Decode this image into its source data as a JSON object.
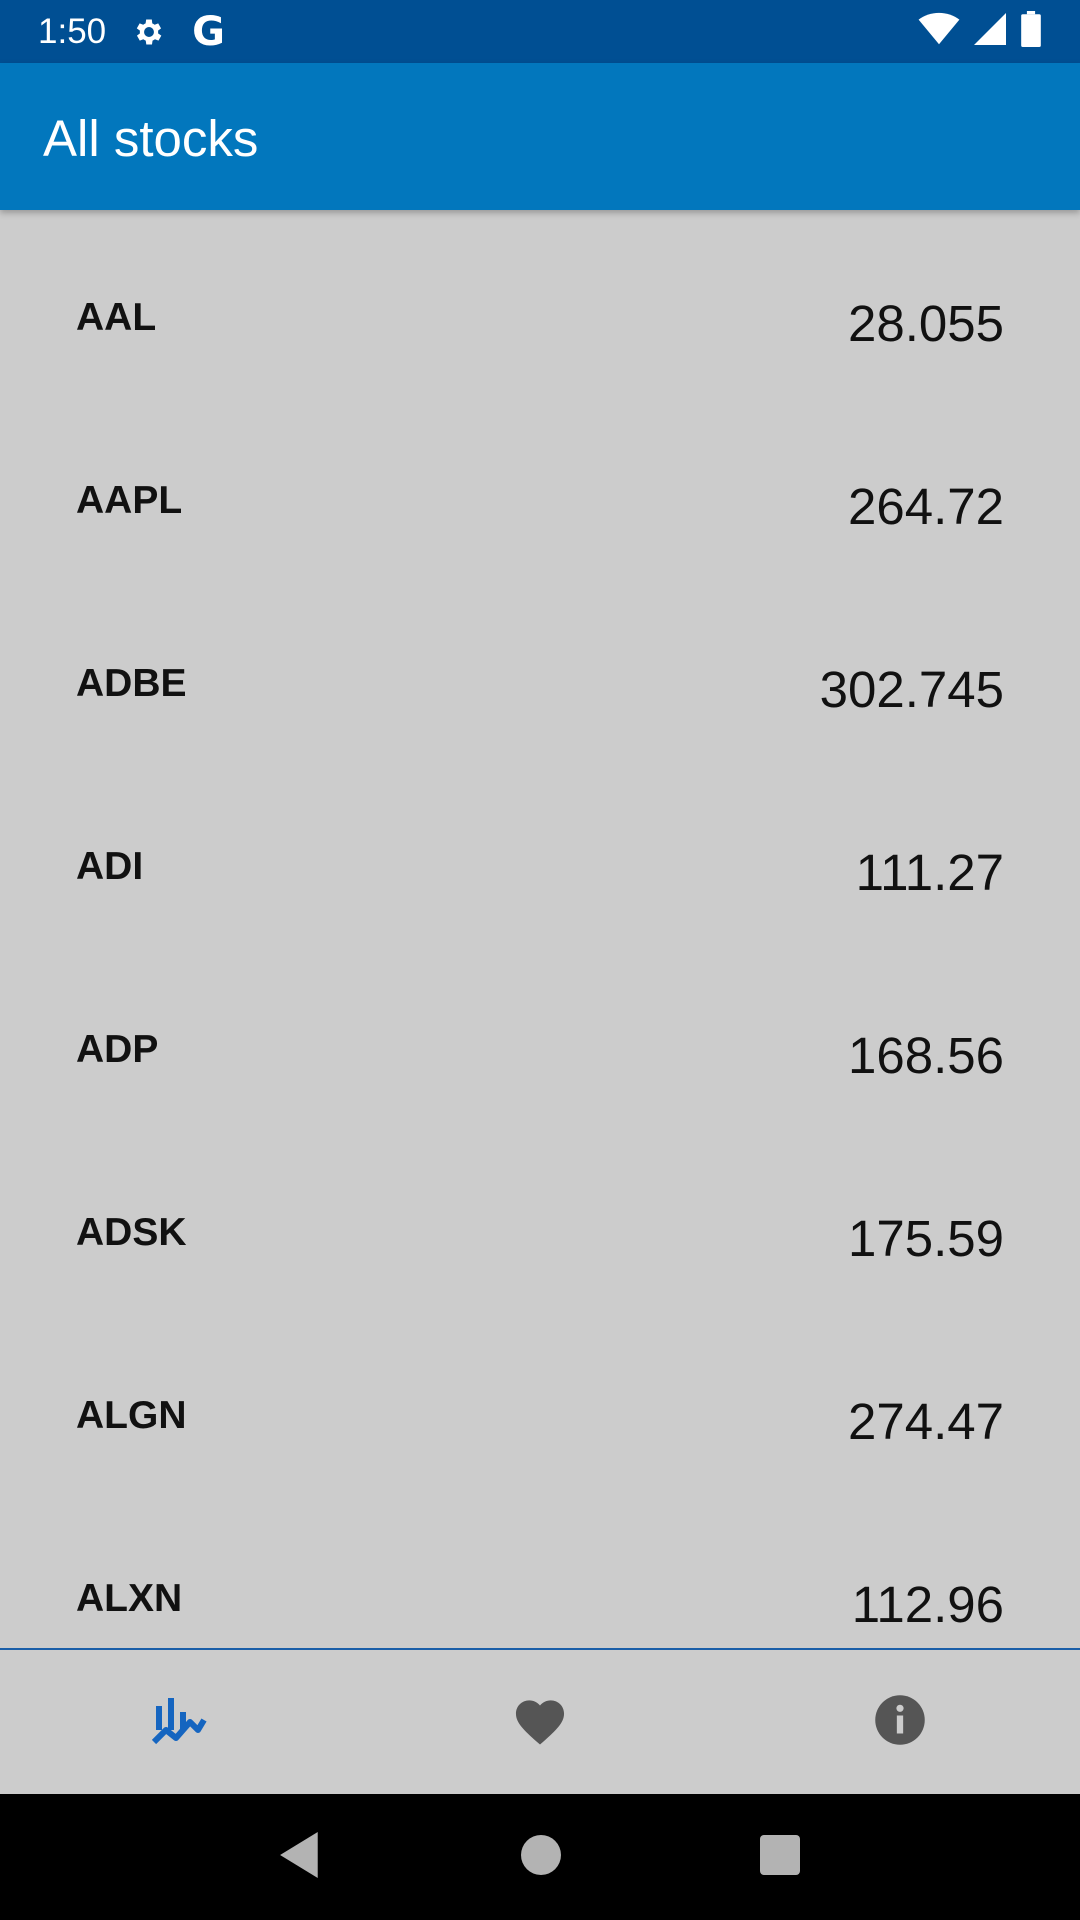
{
  "status_bar": {
    "time": "1:50",
    "icons": [
      "gear-icon",
      "google-g-icon",
      "wifi-icon",
      "signal-icon",
      "battery-icon"
    ],
    "g_letter": "G"
  },
  "app_bar": {
    "title": "All stocks",
    "color": "#0277bd"
  },
  "stocks": [
    {
      "symbol": "AAL",
      "price": "28.055"
    },
    {
      "symbol": "AAPL",
      "price": "264.72"
    },
    {
      "symbol": "ADBE",
      "price": "302.745"
    },
    {
      "symbol": "ADI",
      "price": "111.27"
    },
    {
      "symbol": "ADP",
      "price": "168.56"
    },
    {
      "symbol": "ADSK",
      "price": "175.59"
    },
    {
      "symbol": "ALGN",
      "price": "274.47"
    },
    {
      "symbol": "ALXN",
      "price": "112.96"
    }
  ],
  "bottom_nav": {
    "items": [
      {
        "icon": "stocks-chart-icon",
        "active": true
      },
      {
        "icon": "heart-icon",
        "active": false
      },
      {
        "icon": "info-icon",
        "active": false
      }
    ],
    "active_color": "#1565c0",
    "inactive_color": "#555555"
  },
  "system_nav": {
    "icons": [
      "back-icon",
      "home-icon",
      "recents-icon"
    ]
  }
}
